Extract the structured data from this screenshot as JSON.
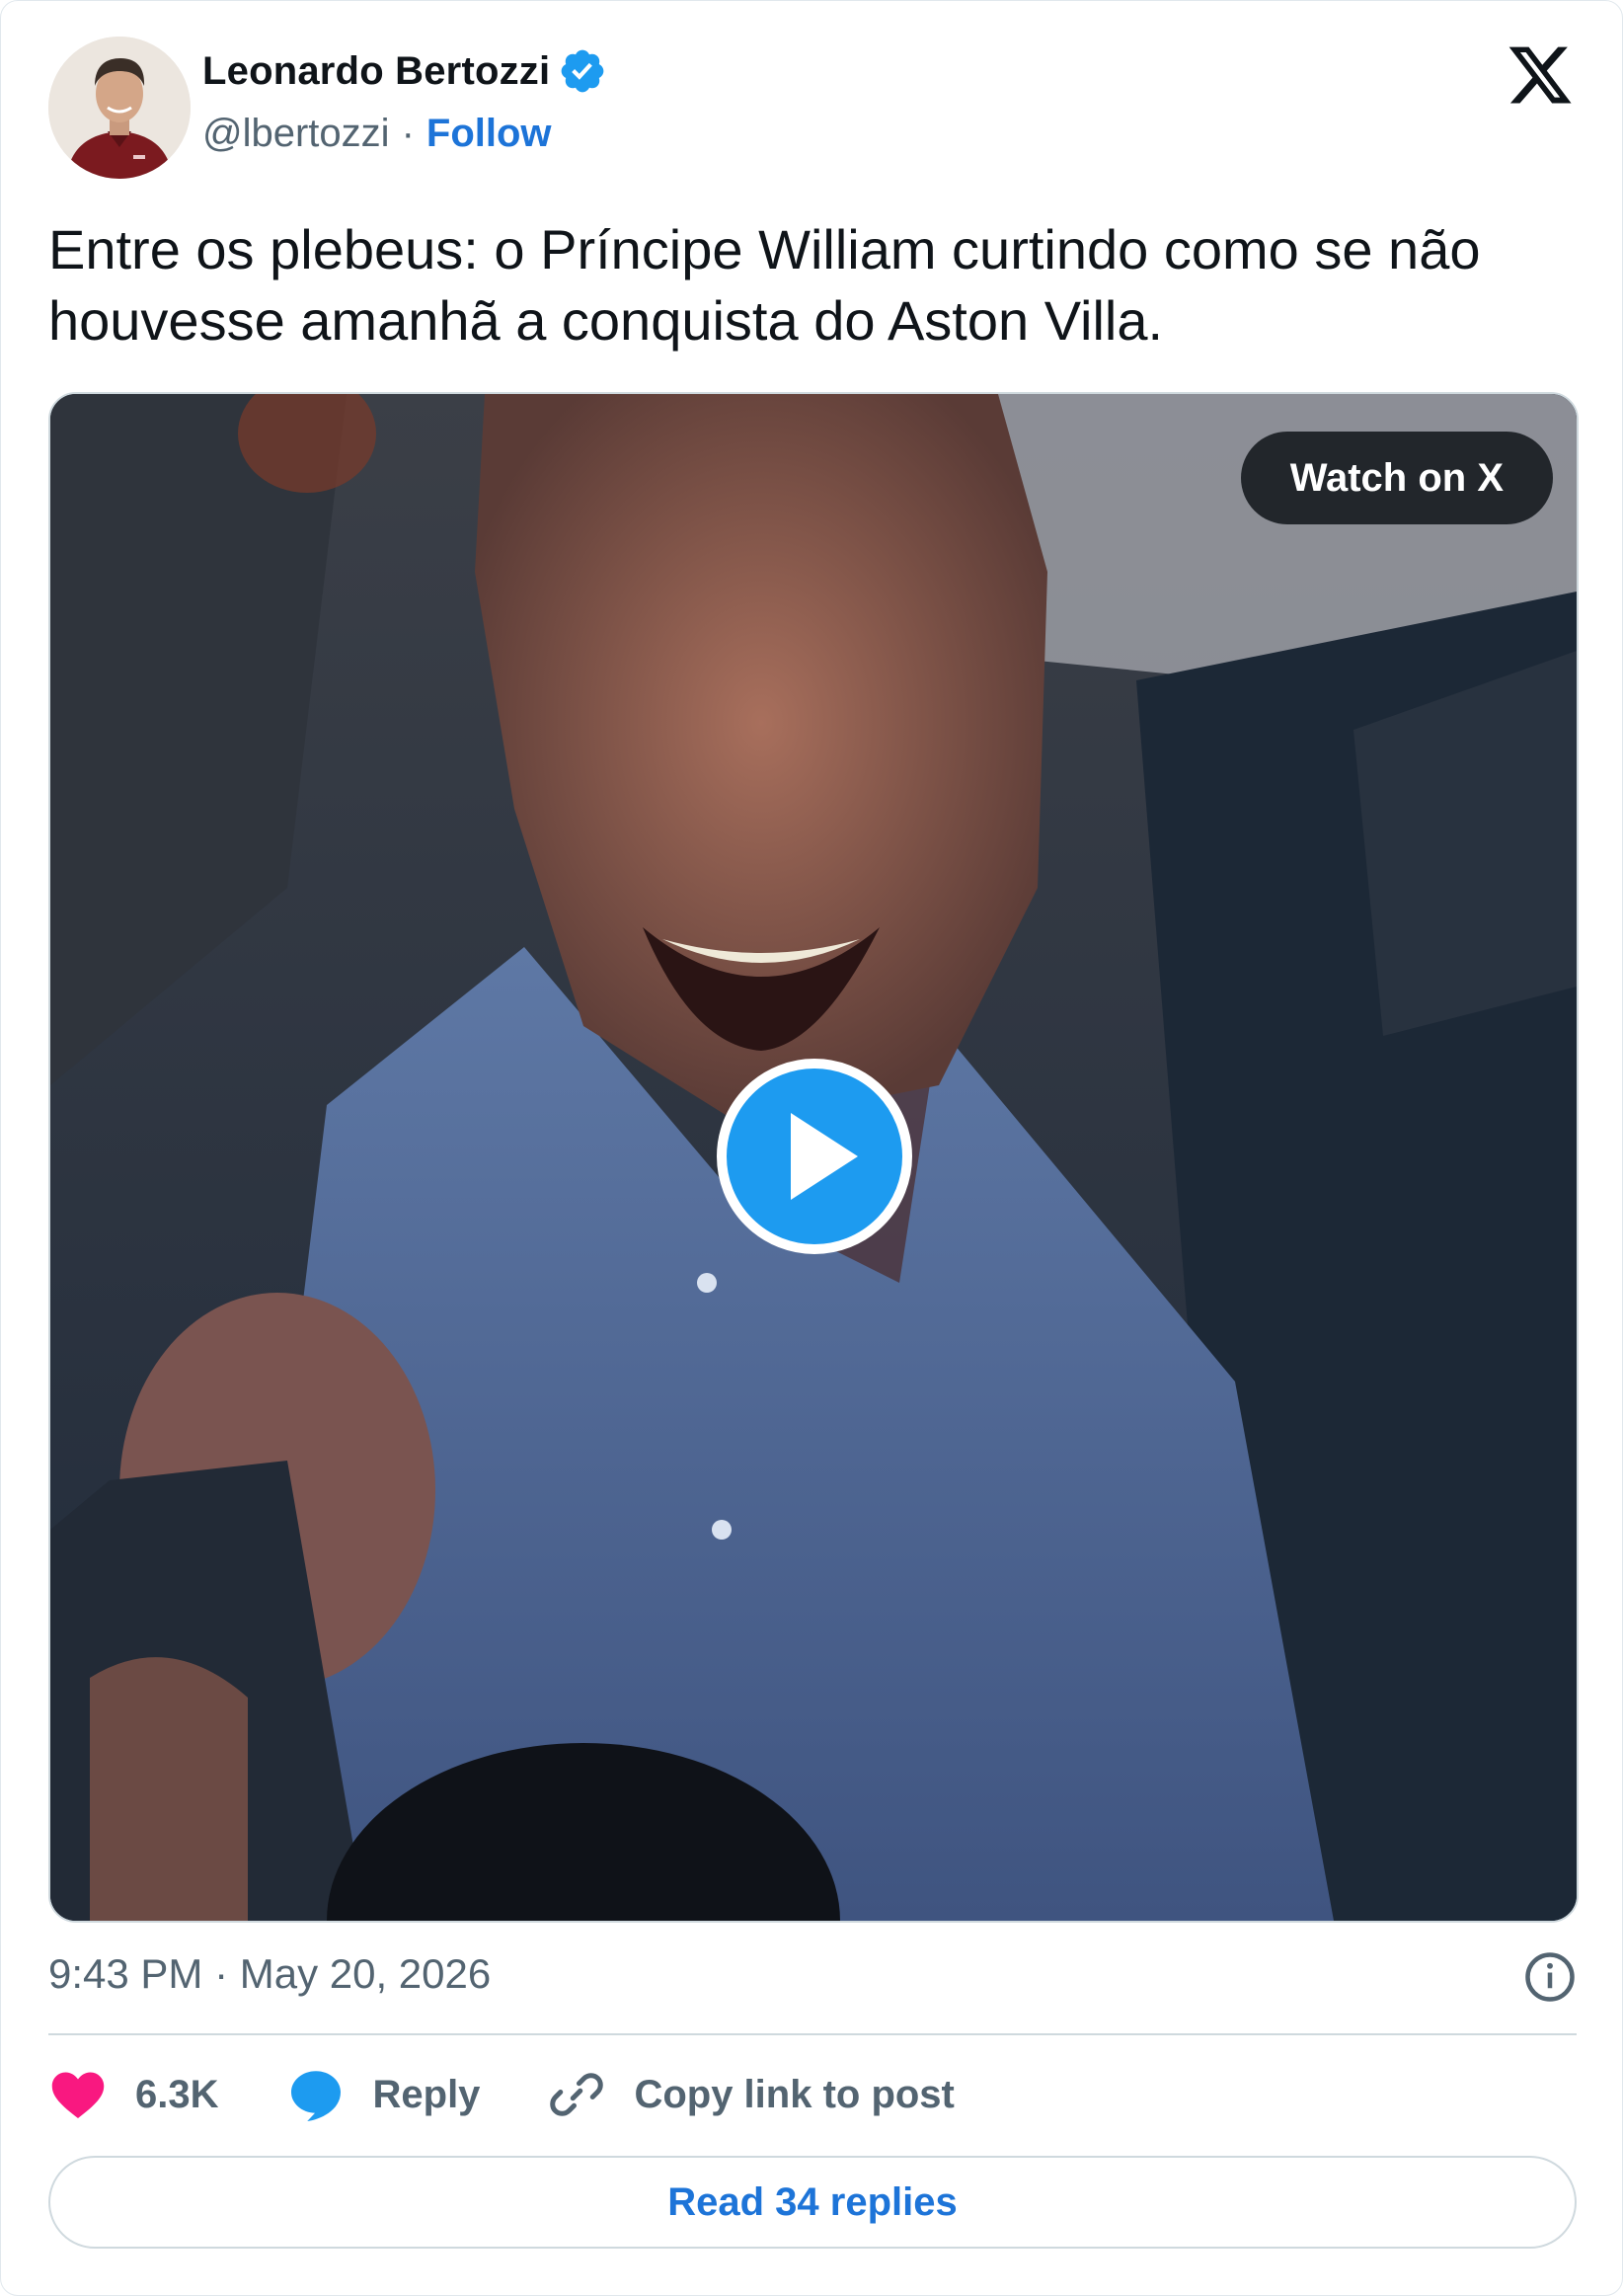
{
  "author": {
    "name": "Leonardo Bertozzi",
    "handle": "@lbertozzi",
    "separator": "·",
    "follow_label": "Follow"
  },
  "tweet": {
    "text": "Entre os plebeus: o Príncipe William curtindo como se não houvesse amanhã a conquista do Aston Villa."
  },
  "media": {
    "watch_label": "Watch on X",
    "play_icon": "play-icon"
  },
  "meta": {
    "timestamp": "9:43 PM · May 20, 2026"
  },
  "actions": {
    "like_count": "6.3K",
    "reply_label": "Reply",
    "copy_label": "Copy link to post"
  },
  "footer": {
    "read_replies_label": "Read 34 replies"
  },
  "colors": {
    "accent": "#1d74d8",
    "like": "#f91880",
    "verified": "#1d9bf0",
    "muted_text": "#536471",
    "border": "#cfd9de"
  }
}
